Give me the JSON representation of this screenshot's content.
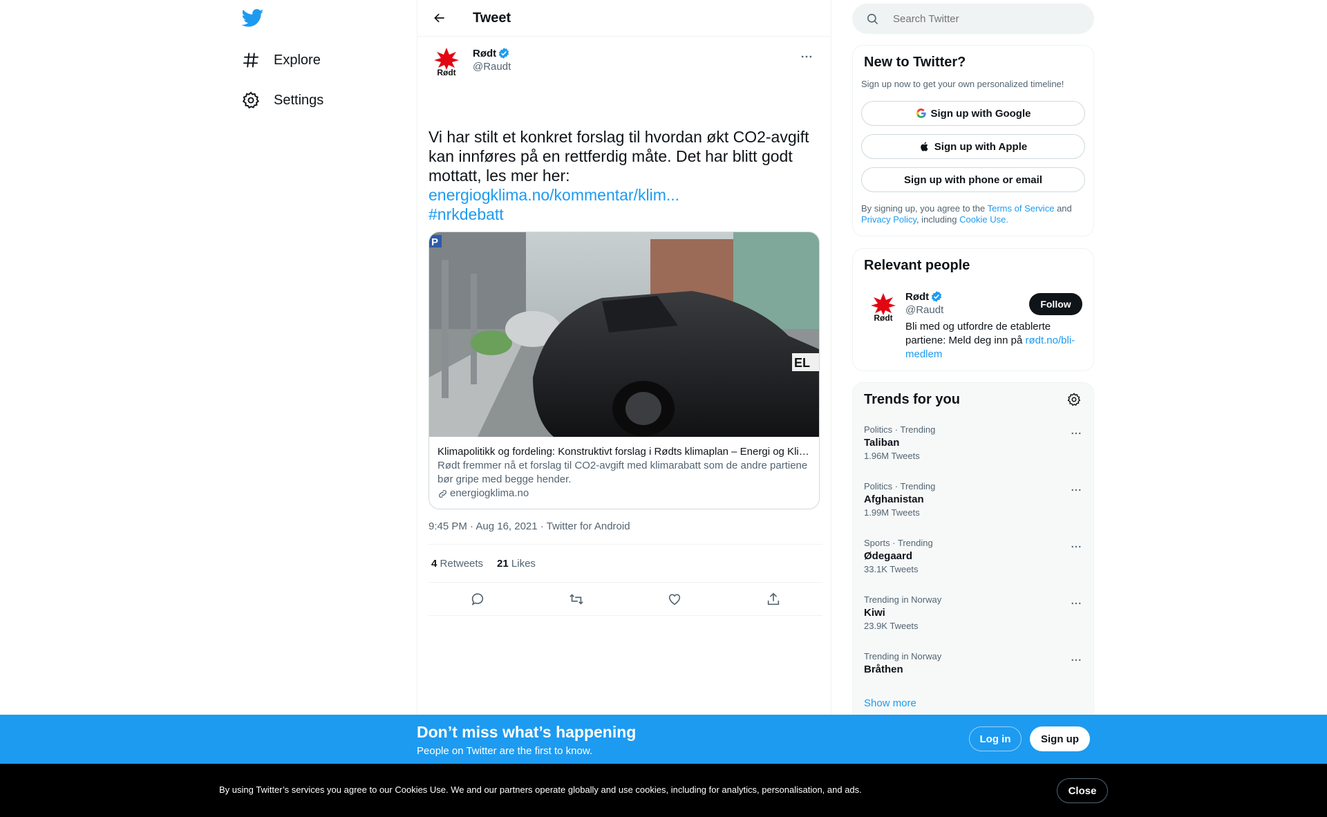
{
  "nav": {
    "logo": "twitter-logo",
    "items": [
      {
        "label": "Explore",
        "icon": "hashtag-icon"
      },
      {
        "label": "Settings",
        "icon": "gear-icon"
      }
    ]
  },
  "header": {
    "title": "Tweet"
  },
  "tweet": {
    "author_name": "Rødt",
    "author_handle": "@Raudt",
    "text": "Vi har stilt et konkret forslag til hvordan økt CO2-avgift kan innføres på en rettferdig måte. Det har blitt godt mottatt, les mer her:",
    "link": "energiogklima.no/kommentar/klim...",
    "hashtag": "#nrkdebatt",
    "card": {
      "title": "Klimapolitikk og fordeling: Konstruktivt forslag i Rødts klimaplan – Energi og Klima",
      "description": "Rødt fremmer nå et forslag til CO2-avgift med klimarabatt som de andre partiene bør gripe med begge hender.",
      "domain": "energiogklima.no"
    },
    "meta": "9:45 PM · Aug 16, 2021 · Twitter for Android",
    "retweets_count": "4",
    "retweets_label": "Retweets",
    "likes_count": "21",
    "likes_label": "Likes"
  },
  "search": {
    "placeholder": "Search Twitter"
  },
  "new_to_twitter": {
    "title": "New to Twitter?",
    "subtitle": "Sign up now to get your own personalized timeline!",
    "google": "Sign up with Google",
    "apple": "Sign up with Apple",
    "phone": "Sign up with phone or email",
    "legal_1": "By signing up, you agree to the",
    "tos": "Terms of Service",
    "and": "and",
    "privacy": "Privacy Policy",
    "including": ", including",
    "cookie": "Cookie Use."
  },
  "relevant_people": {
    "title": "Relevant people",
    "name": "Rødt",
    "handle": "@Raudt",
    "follow": "Follow",
    "bio": "Bli med og utfordre de etablerte partiene: Meld deg inn på",
    "bio_link": "rødt.no/bli-medlem"
  },
  "trends": {
    "title": "Trends for you",
    "items": [
      {
        "category": "Politics · Trending",
        "name": "Taliban",
        "count": "1.96M Tweets"
      },
      {
        "category": "Politics · Trending",
        "name": "Afghanistan",
        "count": "1.99M Tweets"
      },
      {
        "category": "Sports · Trending",
        "name": "Ødegaard",
        "count": "33.1K Tweets"
      },
      {
        "category": "Trending in Norway",
        "name": "Kiwi",
        "count": "23.9K Tweets"
      },
      {
        "category": "Trending in Norway",
        "name": "Bråthen",
        "count": ""
      }
    ],
    "show_more": "Show more"
  },
  "bottom_bar": {
    "title": "Don’t miss what’s happening",
    "subtitle": "People on Twitter are the first to know.",
    "login": "Log in",
    "signup": "Sign up"
  },
  "cookie_bar": {
    "text": "By using Twitter’s services you agree to our Cookies Use. We and our partners operate globally and use cookies, including for analytics, personalisation, and ads.",
    "close": "Close"
  },
  "colors": {
    "brand": "#1d9bf0",
    "rodt_red": "#e20613"
  }
}
